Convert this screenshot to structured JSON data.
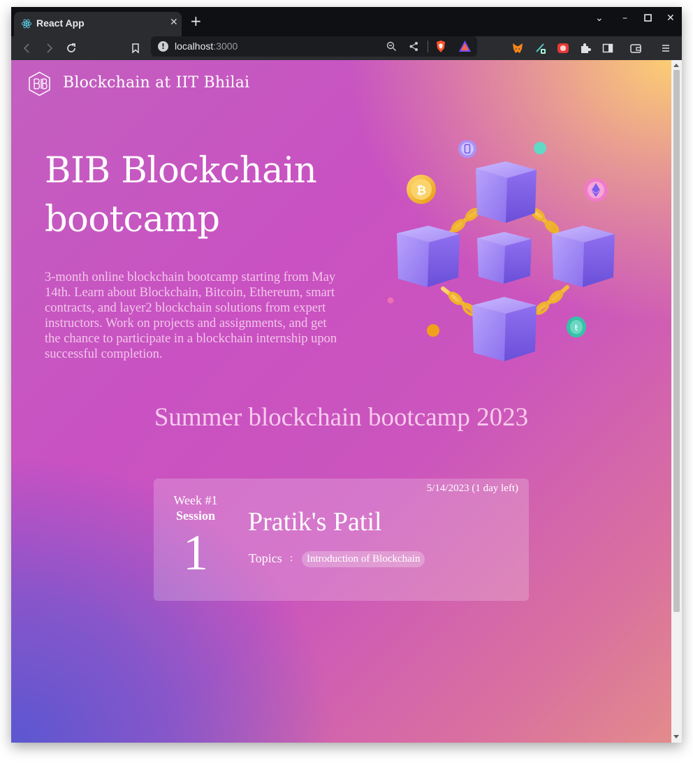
{
  "browser": {
    "tab_title": "React App",
    "tab_icon": "react-icon",
    "url_host": "localhost",
    "url_port": ":3000"
  },
  "site": {
    "brand_name": "Blockchain at IIT Bhilai"
  },
  "hero": {
    "title": "BIB Blockchain bootcamp",
    "description": "3-month online blockchain bootcamp starting from May 14th. Learn about Blockchain, Bitcoin, Ethereum, smart contracts, and layer2 blockchain solutions from expert instructors. Work on projects and assignments, and get the chance to participate in a blockchain internship upon successful completion."
  },
  "section": {
    "title": "Summer blockchain bootcamp 2023"
  },
  "sessions": [
    {
      "date": "5/14/2023 (1 day left)",
      "week": "Week #1",
      "session_label": "Session",
      "number": "1",
      "speaker": "Pratik's Patil",
      "topics_label": "Topics",
      "topics_separator": ":",
      "topics": [
        "Introduction of Blockchain"
      ]
    }
  ],
  "colors": {
    "gradient_top_right": "#fccd73",
    "gradient_center": "#c951c2",
    "gradient_bottom_left": "#5b57d1",
    "cube": "#8d74f2",
    "chain": "#f3b83a"
  }
}
